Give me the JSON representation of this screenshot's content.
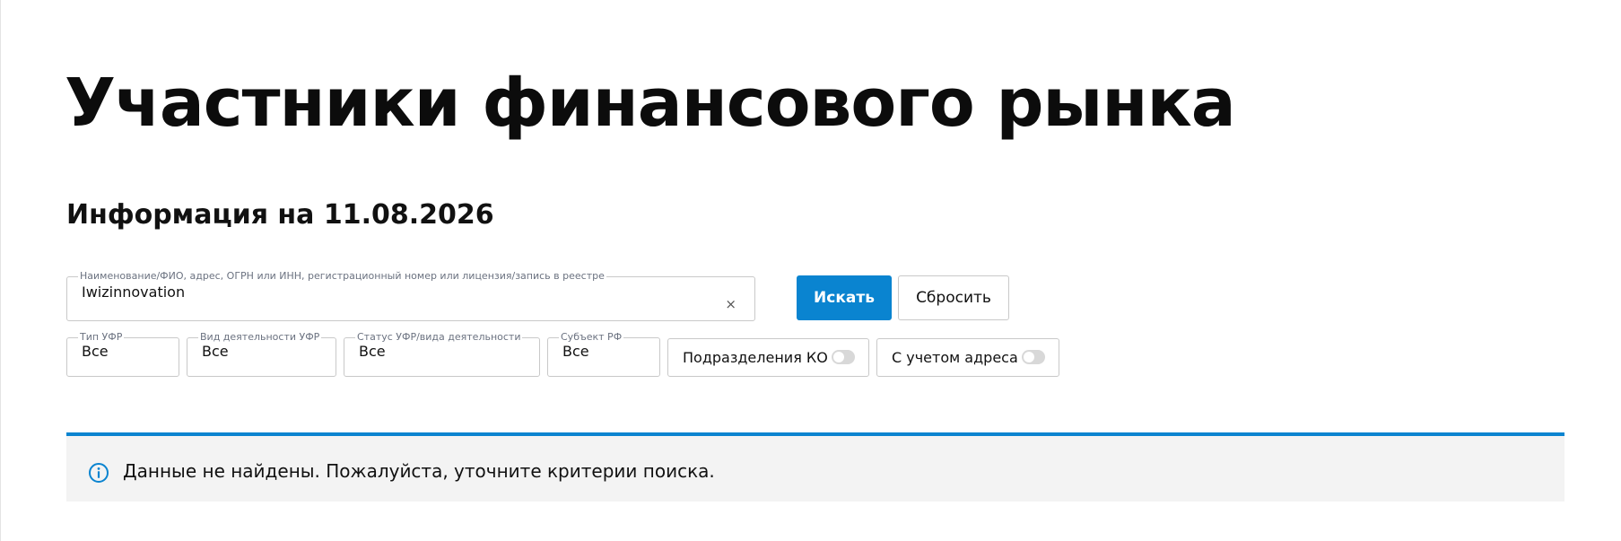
{
  "page": {
    "title": "Участники финансового рынка",
    "info_date": "Информация на 11.08.2026"
  },
  "search": {
    "legend": "Наименование/ФИО, адрес, ОГРН или ИНН, регистрационный номер или лицензия/запись в реестре",
    "value": "Iwizinnovation",
    "clear_glyph": "×",
    "search_button": "Искать",
    "reset_button": "Сбросить"
  },
  "filters": [
    {
      "legend": "Тип УФР",
      "value": "Все"
    },
    {
      "legend": "Вид деятельности УФР",
      "value": "Все"
    },
    {
      "legend": "Статус УФР/вида деятельности",
      "value": "Все"
    },
    {
      "legend": "Субъект РФ",
      "value": "Все"
    }
  ],
  "toggles": [
    {
      "label": "Подразделения КО",
      "on": false
    },
    {
      "label": "С учетом адреса",
      "on": false
    }
  ],
  "notice": {
    "icon": "info-icon",
    "text": "Данные не найдены. Пожалуйста, уточните критерии поиска."
  },
  "colors": {
    "accent": "#0a84d0",
    "notice_bg": "#f3f3f3",
    "border": "#c9c9c9",
    "text": "#111111"
  }
}
